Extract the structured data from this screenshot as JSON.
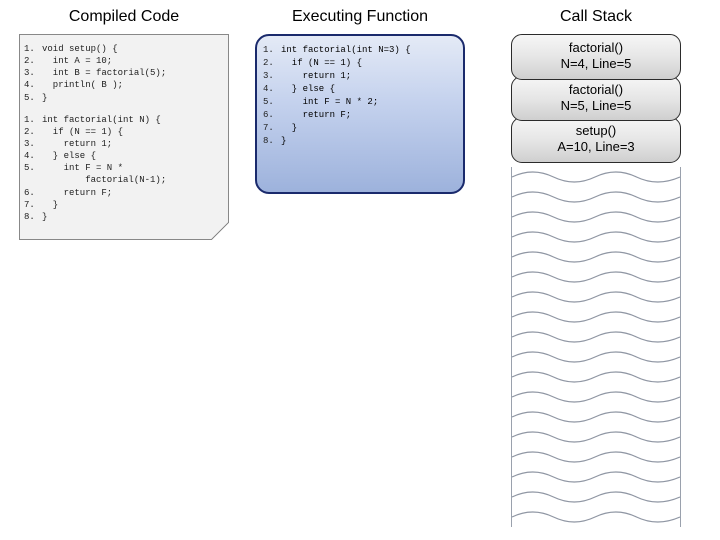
{
  "columns": {
    "compiled": "Compiled Code",
    "executing": "Executing Function",
    "stack": "Call Stack"
  },
  "compiled_code": [
    {
      "n": "1.",
      "t": "void setup() {"
    },
    {
      "n": "2.",
      "t": "  int A = 10;"
    },
    {
      "n": "3.",
      "t": "  int B = factorial(5);"
    },
    {
      "n": "4.",
      "t": "  println( B );"
    },
    {
      "n": "5.",
      "t": "}"
    }
  ],
  "compiled_code2": [
    {
      "n": "1.",
      "t": "int factorial(int N) {"
    },
    {
      "n": "2.",
      "t": "  if (N == 1) {"
    },
    {
      "n": "3.",
      "t": "    return 1;"
    },
    {
      "n": "4.",
      "t": "  } else {"
    },
    {
      "n": "5.",
      "t": "    int F = N *"
    },
    {
      "n": "",
      "t": "        factorial(N-1);"
    },
    {
      "n": "6.",
      "t": "    return F;"
    },
    {
      "n": "7.",
      "t": "  }"
    },
    {
      "n": "8.",
      "t": "}"
    }
  ],
  "executing_code": [
    {
      "n": "1.",
      "t": "int factorial(int N=3) {"
    },
    {
      "n": "2.",
      "t": "  if (N == 1) {"
    },
    {
      "n": "3.",
      "t": "    return 1;"
    },
    {
      "n": "4.",
      "t": "  } else {"
    },
    {
      "n": "5.",
      "t": "    int F = N * 2;"
    },
    {
      "n": "6.",
      "t": "    return F;"
    },
    {
      "n": "7.",
      "t": "  }"
    },
    {
      "n": "8.",
      "t": "}"
    }
  ],
  "call_stack": [
    {
      "fn": "factorial()",
      "info": "N=4, Line=5"
    },
    {
      "fn": "factorial()",
      "info": "N=5, Line=5"
    },
    {
      "fn": "setup()",
      "info": "A=10, Line=3"
    }
  ]
}
